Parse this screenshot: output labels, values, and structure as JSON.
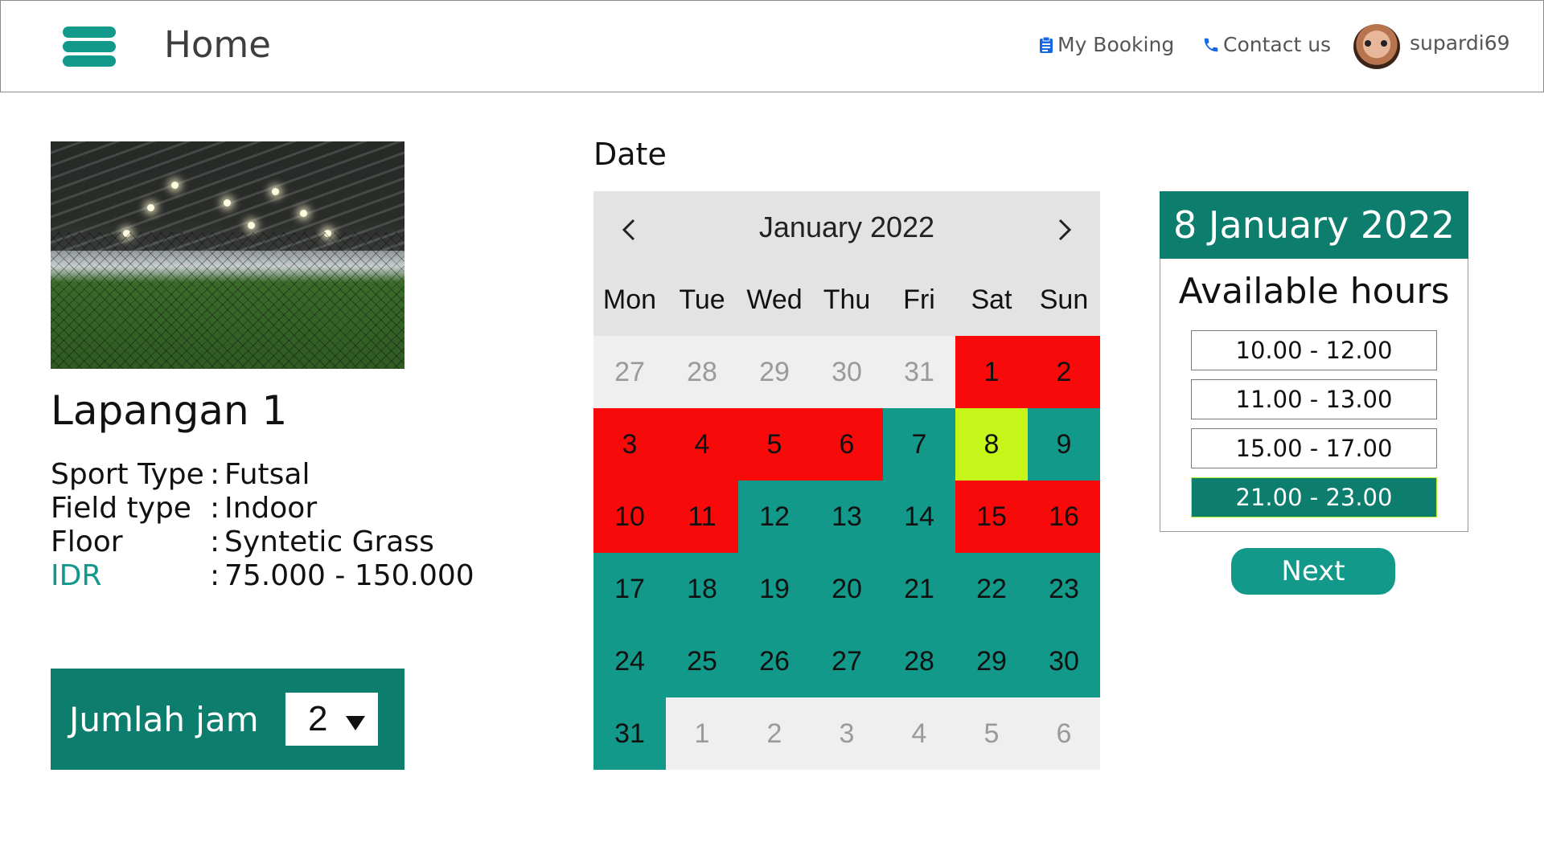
{
  "nav": {
    "title": "Home",
    "my_booking": "My Booking",
    "contact_us": "Contact us",
    "username": "supardi69"
  },
  "court": {
    "name": "Lapangan 1",
    "specs": [
      {
        "label": "Sport Type",
        "value": "Futsal"
      },
      {
        "label": "Field type",
        "value": "Indoor"
      },
      {
        "label": "Floor",
        "value": "Syntetic Grass"
      },
      {
        "label": "IDR",
        "value": "75.000 - 150.000"
      }
    ]
  },
  "hours_selector": {
    "label": "Jumlah jam",
    "value": "2"
  },
  "date_section": {
    "label": "Date",
    "month_label": "January 2022",
    "weekdays": [
      "Mon",
      "Tue",
      "Wed",
      "Thu",
      "Fri",
      "Sat",
      "Sun"
    ],
    "days": [
      {
        "d": "27",
        "s": "other"
      },
      {
        "d": "28",
        "s": "other"
      },
      {
        "d": "29",
        "s": "other"
      },
      {
        "d": "30",
        "s": "other"
      },
      {
        "d": "31",
        "s": "other"
      },
      {
        "d": "1",
        "s": "booked"
      },
      {
        "d": "2",
        "s": "booked"
      },
      {
        "d": "3",
        "s": "booked"
      },
      {
        "d": "4",
        "s": "booked"
      },
      {
        "d": "5",
        "s": "booked"
      },
      {
        "d": "6",
        "s": "booked"
      },
      {
        "d": "7",
        "s": "available"
      },
      {
        "d": "8",
        "s": "selected"
      },
      {
        "d": "9",
        "s": "available"
      },
      {
        "d": "10",
        "s": "booked"
      },
      {
        "d": "11",
        "s": "booked"
      },
      {
        "d": "12",
        "s": "available"
      },
      {
        "d": "13",
        "s": "available"
      },
      {
        "d": "14",
        "s": "available"
      },
      {
        "d": "15",
        "s": "booked"
      },
      {
        "d": "16",
        "s": "booked"
      },
      {
        "d": "17",
        "s": "available"
      },
      {
        "d": "18",
        "s": "available"
      },
      {
        "d": "19",
        "s": "available"
      },
      {
        "d": "20",
        "s": "available"
      },
      {
        "d": "21",
        "s": "available"
      },
      {
        "d": "22",
        "s": "available"
      },
      {
        "d": "23",
        "s": "available"
      },
      {
        "d": "24",
        "s": "available"
      },
      {
        "d": "25",
        "s": "available"
      },
      {
        "d": "26",
        "s": "available"
      },
      {
        "d": "27",
        "s": "available"
      },
      {
        "d": "28",
        "s": "available"
      },
      {
        "d": "29",
        "s": "available"
      },
      {
        "d": "30",
        "s": "available"
      },
      {
        "d": "31",
        "s": "available"
      },
      {
        "d": "1",
        "s": "other"
      },
      {
        "d": "2",
        "s": "other"
      },
      {
        "d": "3",
        "s": "other"
      },
      {
        "d": "4",
        "s": "other"
      },
      {
        "d": "5",
        "s": "other"
      },
      {
        "d": "6",
        "s": "other"
      }
    ]
  },
  "availability": {
    "date_title": "8 January 2022",
    "title": "Available hours",
    "slots": [
      {
        "label": "10.00 - 12.00",
        "active": false
      },
      {
        "label": "11.00 - 13.00",
        "active": false
      },
      {
        "label": "15.00 - 17.00",
        "active": false
      },
      {
        "label": "21.00 - 23.00",
        "active": true
      }
    ],
    "next_label": "Next"
  },
  "colors": {
    "teal": "#12998a",
    "dark_teal": "#0d7d6e",
    "booked_red": "#f80a0b",
    "selected_yellow": "#c5f519",
    "link_blue": "#1668e3"
  }
}
